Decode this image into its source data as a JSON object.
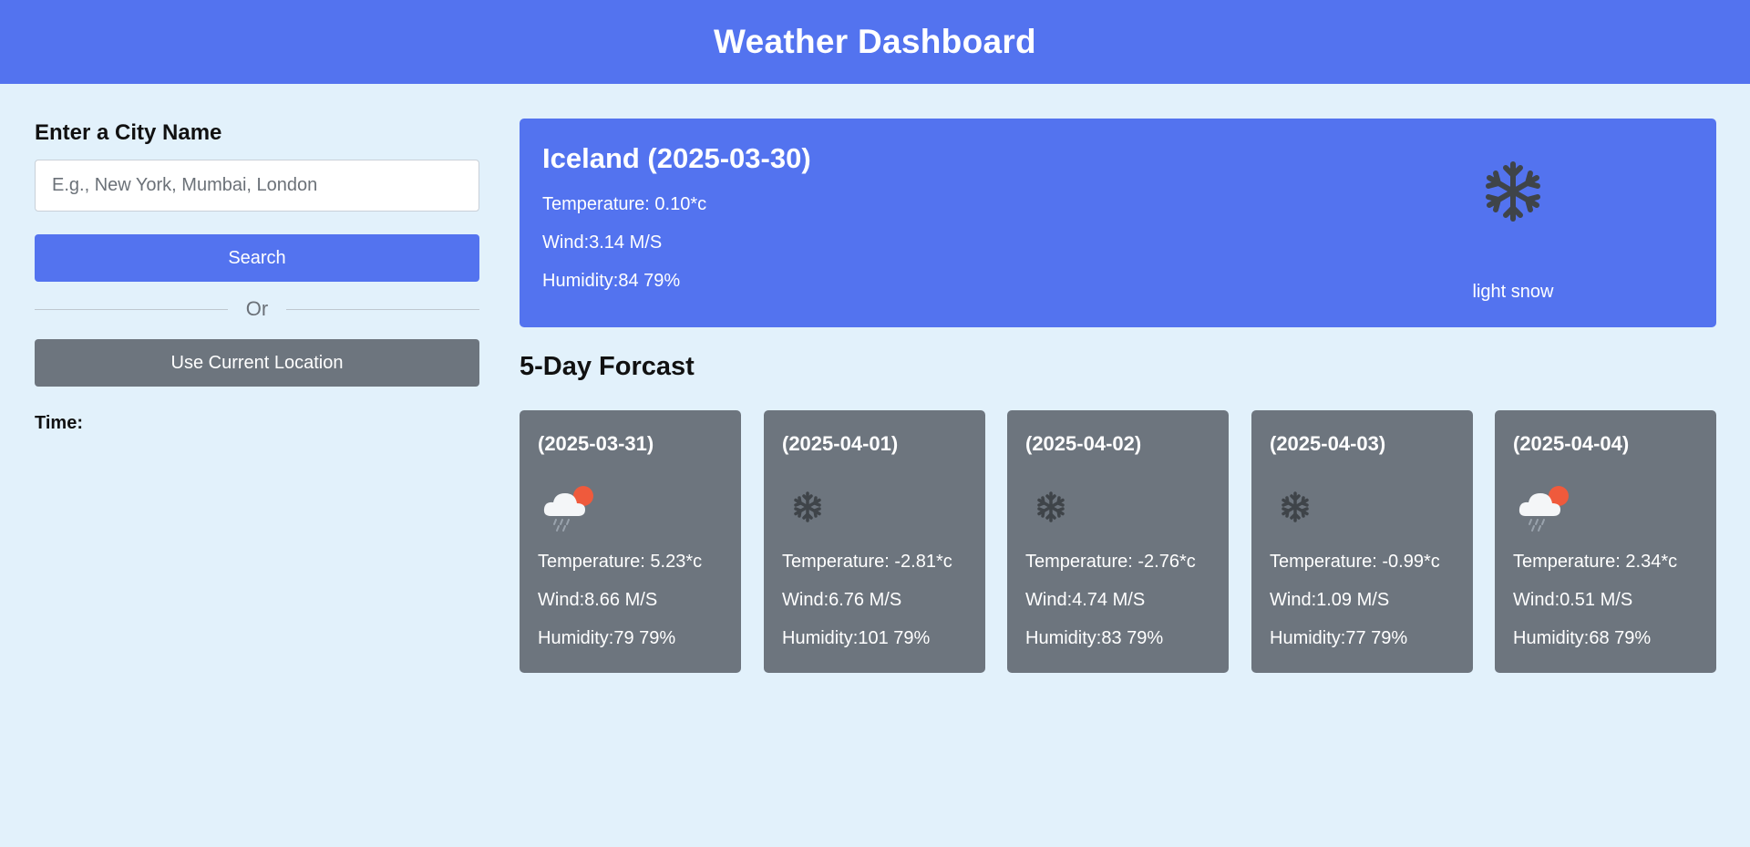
{
  "header": {
    "title": "Weather Dashboard"
  },
  "sidebar": {
    "title": "Enter a City Name",
    "search_placeholder": "E.g., New York, Mumbai, London",
    "search_label": "Search",
    "or_label": "Or",
    "location_label": "Use Current Location",
    "time_label": "Time:"
  },
  "current": {
    "title": "Iceland (2025-03-30)",
    "temperature": "Temperature: 0.10*c",
    "wind": "Wind:3.14 M/S",
    "humidity": "Humidity:84 79%",
    "description": "light snow",
    "icon": "snowflake-icon"
  },
  "forecast": {
    "title": "5-Day Forcast",
    "days": [
      {
        "date": "(2025-03-31)",
        "icon": "cloud-rain-sun-icon",
        "temperature": "Temperature: 5.23*c",
        "wind": "Wind:8.66 M/S",
        "humidity": "Humidity:79 79%"
      },
      {
        "date": "(2025-04-01)",
        "icon": "snowflake-icon",
        "temperature": "Temperature: -2.81*c",
        "wind": "Wind:6.76 M/S",
        "humidity": "Humidity:101 79%"
      },
      {
        "date": "(2025-04-02)",
        "icon": "snowflake-icon",
        "temperature": "Temperature: -2.76*c",
        "wind": "Wind:4.74 M/S",
        "humidity": "Humidity:83 79%"
      },
      {
        "date": "(2025-04-03)",
        "icon": "snowflake-icon",
        "temperature": "Temperature: -0.99*c",
        "wind": "Wind:1.09 M/S",
        "humidity": "Humidity:77 79%"
      },
      {
        "date": "(2025-04-04)",
        "icon": "cloud-rain-sun-icon",
        "temperature": "Temperature: 2.34*c",
        "wind": "Wind:0.51 M/S",
        "humidity": "Humidity:68 79%"
      }
    ]
  },
  "colors": {
    "primary": "#5373ef",
    "secondary": "#6d757e",
    "background": "#e2f1fb"
  }
}
